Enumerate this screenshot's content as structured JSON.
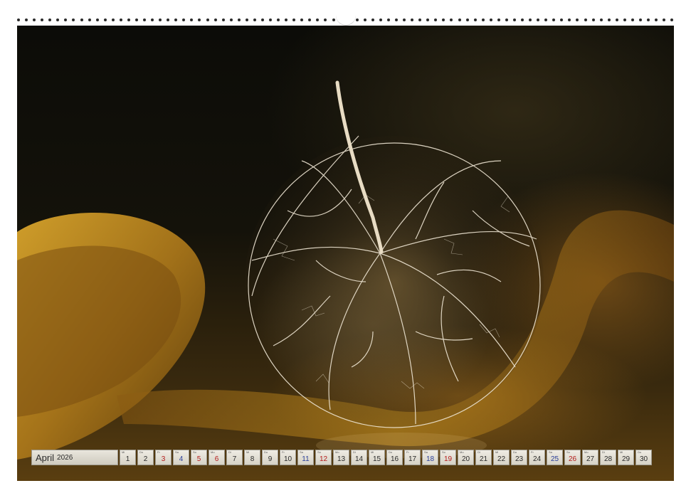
{
  "calendar": {
    "month": "April",
    "year": "2026",
    "days": [
      {
        "num": "1",
        "wd": "Mi",
        "type": "weekday"
      },
      {
        "num": "2",
        "wd": "Do",
        "type": "weekday"
      },
      {
        "num": "3",
        "wd": "Fr",
        "type": "holiday"
      },
      {
        "num": "4",
        "wd": "Sa",
        "type": "saturday"
      },
      {
        "num": "5",
        "wd": "So",
        "type": "sunday"
      },
      {
        "num": "6",
        "wd": "Mo",
        "type": "holiday"
      },
      {
        "num": "7",
        "wd": "Di",
        "type": "weekday"
      },
      {
        "num": "8",
        "wd": "Mi",
        "type": "weekday"
      },
      {
        "num": "9",
        "wd": "Do",
        "type": "weekday"
      },
      {
        "num": "10",
        "wd": "Fr",
        "type": "weekday"
      },
      {
        "num": "11",
        "wd": "Sa",
        "type": "saturday"
      },
      {
        "num": "12",
        "wd": "So",
        "type": "sunday"
      },
      {
        "num": "13",
        "wd": "Mo",
        "type": "weekday"
      },
      {
        "num": "14",
        "wd": "Di",
        "type": "weekday"
      },
      {
        "num": "15",
        "wd": "Mi",
        "type": "weekday"
      },
      {
        "num": "16",
        "wd": "Do",
        "type": "weekday"
      },
      {
        "num": "17",
        "wd": "Fr",
        "type": "weekday"
      },
      {
        "num": "18",
        "wd": "Sa",
        "type": "saturday"
      },
      {
        "num": "19",
        "wd": "So",
        "type": "sunday"
      },
      {
        "num": "20",
        "wd": "Mo",
        "type": "weekday"
      },
      {
        "num": "21",
        "wd": "Di",
        "type": "weekday"
      },
      {
        "num": "22",
        "wd": "Mi",
        "type": "weekday"
      },
      {
        "num": "23",
        "wd": "Do",
        "type": "weekday"
      },
      {
        "num": "24",
        "wd": "Fr",
        "type": "weekday"
      },
      {
        "num": "25",
        "wd": "Sa",
        "type": "saturday"
      },
      {
        "num": "26",
        "wd": "So",
        "type": "sunday"
      },
      {
        "num": "27",
        "wd": "Mo",
        "type": "weekday"
      },
      {
        "num": "28",
        "wd": "Di",
        "type": "weekday"
      },
      {
        "num": "29",
        "wd": "Mi",
        "type": "weekday"
      },
      {
        "num": "30",
        "wd": "Do",
        "type": "weekday"
      }
    ]
  },
  "colors": {
    "sunday": "#b51c1c",
    "saturday": "#2a3f9a",
    "ribbon": "#c08a1c",
    "background": "#0c0c08"
  },
  "photo": {
    "subject_icon": "physalis-lantern-icon"
  }
}
